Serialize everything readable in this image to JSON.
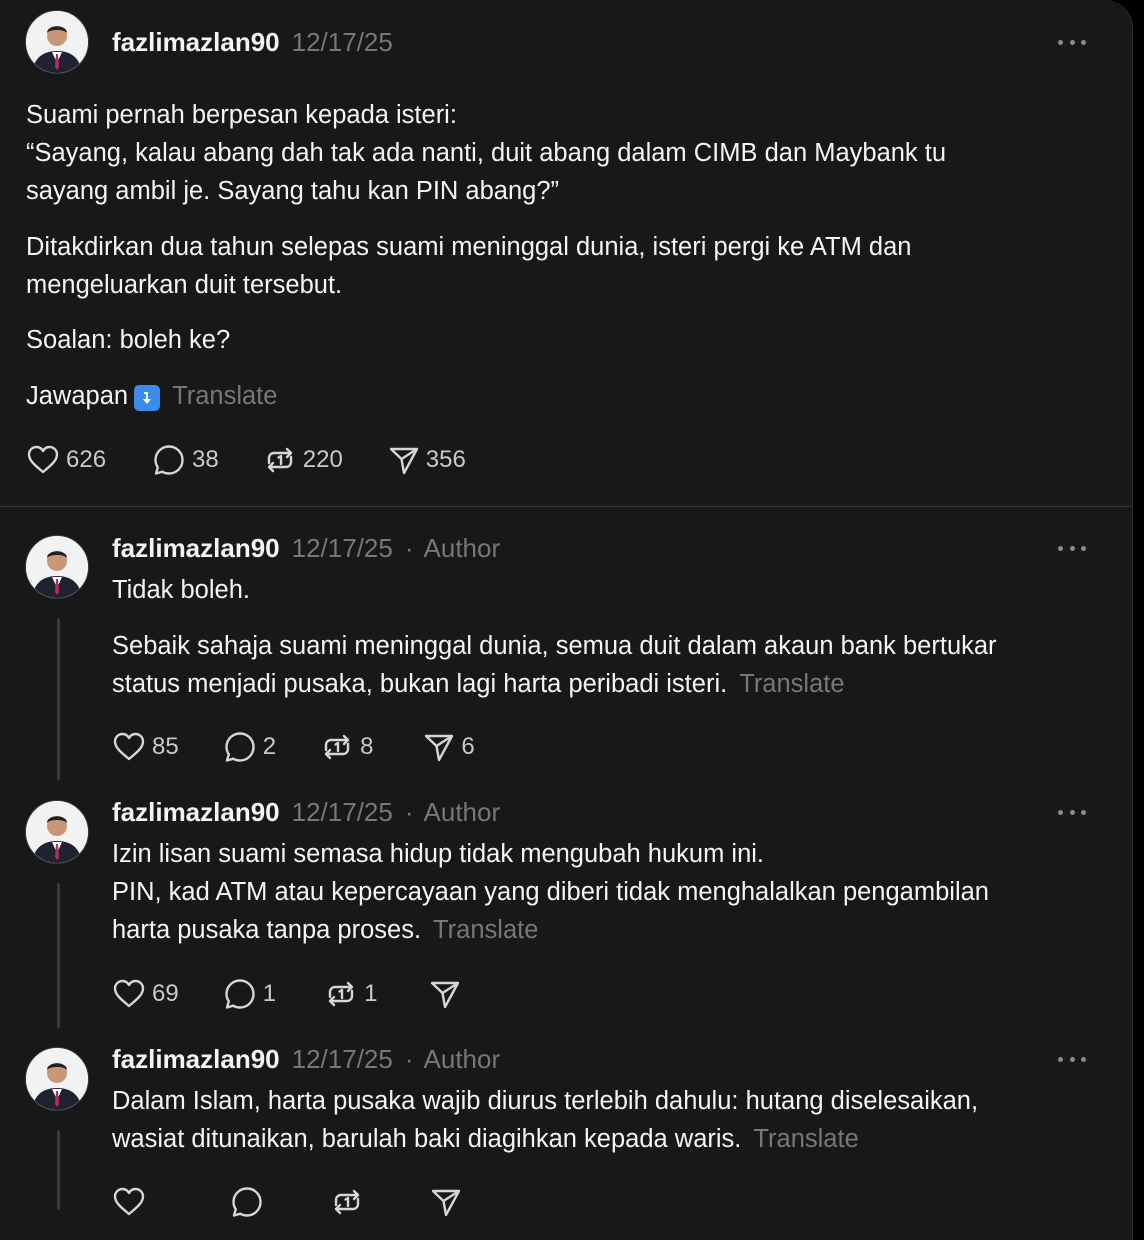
{
  "main_post": {
    "username": "fazlimazlan90",
    "date": "12/17/25",
    "paragraphs": [
      "Suami pernah berpesan kepada isteri:",
      "“Sayang, kalau abang dah tak ada nanti, duit abang dalam CIMB dan Maybank tu",
      "sayang ambil je. Sayang tahu kan PIN abang?”",
      "Ditakdirkan dua tahun selepas suami meninggal dunia, isteri pergi ke ATM dan",
      "mengeluarkan duit tersebut.",
      "Soalan: boleh ke?",
      "Jawapan"
    ],
    "translate": "Translate",
    "likes": "626",
    "replies": "38",
    "reposts": "220",
    "shares": "356"
  },
  "replies": [
    {
      "username": "fazlimazlan90",
      "date": "12/17/25",
      "author": "Author",
      "lines": [
        "Tidak boleh.",
        "Sebaik sahaja suami meninggal dunia, semua duit dalam akaun bank bertukar",
        "status menjadi pusaka, bukan lagi harta peribadi isteri."
      ],
      "translate": "Translate",
      "likes": "85",
      "replies": "2",
      "reposts": "8",
      "shares": "6"
    },
    {
      "username": "fazlimazlan90",
      "date": "12/17/25",
      "author": "Author",
      "lines": [
        "Izin lisan suami semasa hidup tidak mengubah hukum ini.",
        "PIN, kad ATM atau kepercayaan yang diberi tidak menghalalkan pengambilan",
        "harta pusaka tanpa proses."
      ],
      "translate": "Translate",
      "likes": "69",
      "replies": "1",
      "reposts": "1",
      "shares": ""
    },
    {
      "username": "fazlimazlan90",
      "date": "12/17/25",
      "author": "Author",
      "lines": [
        "Dalam Islam, harta pusaka wajib diurus terlebih dahulu: hutang diselesaikan,",
        "wasiat ditunaikan, barulah baki diagihkan kepada waris."
      ],
      "translate": "Translate"
    }
  ],
  "separator_dot": "·",
  "icons": {
    "like": "heart-icon",
    "reply": "speech-bubble-icon",
    "repost": "repost-icon",
    "share": "paper-plane-icon",
    "more": "more-dots-icon",
    "emoji": "down-arrow-emoji-icon"
  },
  "colors": {
    "background": "#181818",
    "text": "#f3f5f7",
    "muted": "#777777",
    "emoji_blue": "#3d8be8"
  }
}
